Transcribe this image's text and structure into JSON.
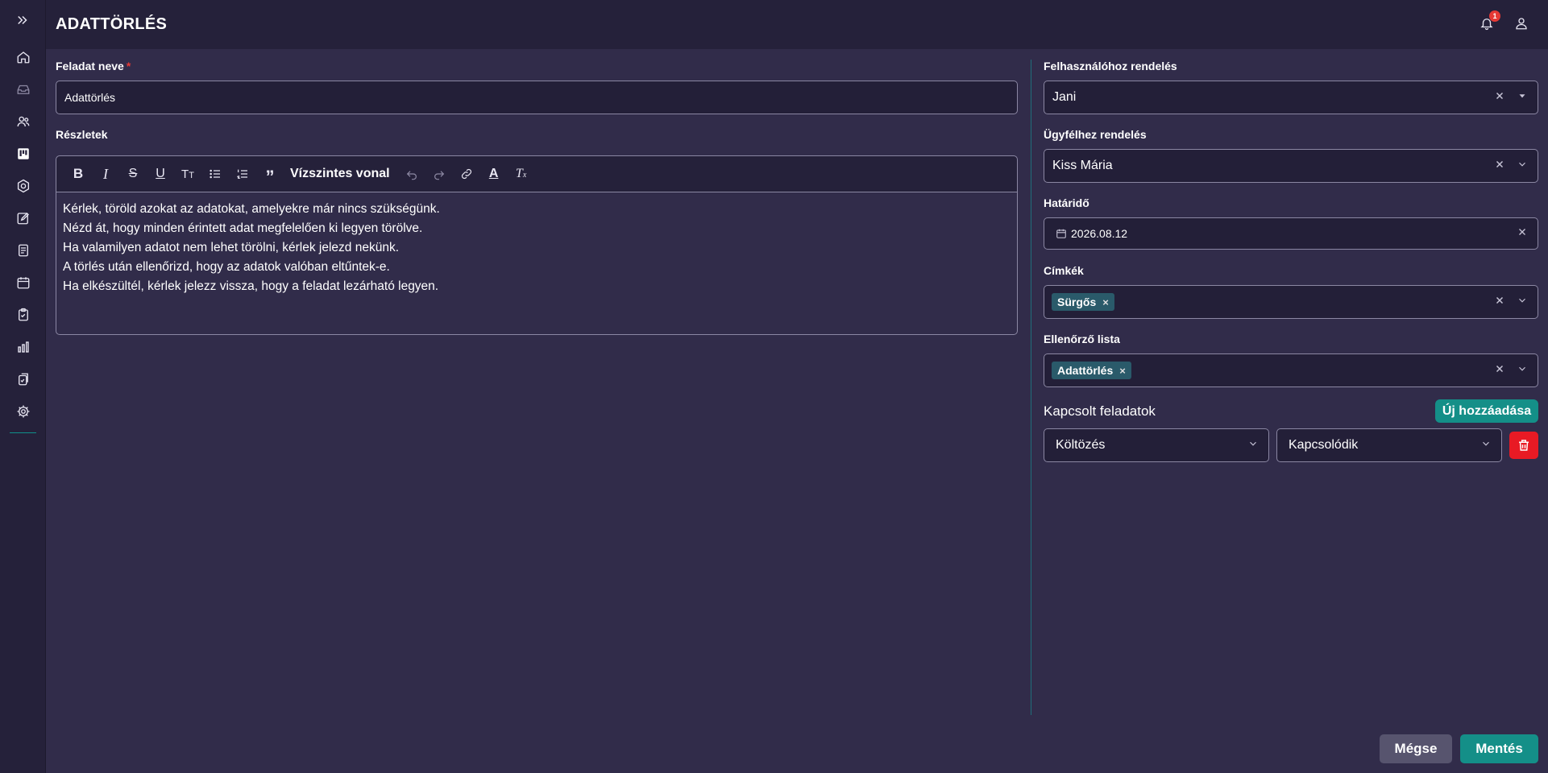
{
  "header": {
    "title": "ADATTÖRLÉS",
    "notification_count": "1"
  },
  "sidebar": {
    "icons": [
      "home-icon",
      "inbox-icon",
      "users-icon",
      "kanban-icon",
      "settings-cog-icon",
      "edit-icon",
      "document-icon",
      "calendar-icon",
      "clipboard-check-icon",
      "bar-chart-icon",
      "clipboard-copy-icon",
      "gear-icon"
    ]
  },
  "form": {
    "task_name_label": "Feladat neve",
    "required_marker": "*",
    "task_name_value": "Adattörlés",
    "details_label": "Részletek",
    "toolbar": {
      "horizontal_rule_label": "Vízszintes vonal"
    },
    "details_lines": [
      "Kérlek, töröld azokat az adatokat, amelyekre már nincs szükségünk.",
      "Nézd át, hogy minden érintett adat megfelelően ki legyen törölve.",
      "Ha valamilyen adatot nem lehet törölni, kérlek jelezd nekünk.",
      "A törlés után ellenőrizd, hogy az adatok valóban eltűntek-e.",
      "Ha elkészültél, kérlek jelezz vissza, hogy a feladat lezárható legyen."
    ]
  },
  "right": {
    "assign_user_label": "Felhasználóhoz rendelés",
    "assign_user_value": "Jani",
    "assign_client_label": "Ügyfélhez rendelés",
    "assign_client_value": "Kiss Mária",
    "deadline_label": "Határidő",
    "deadline_value": "2026.08.12",
    "tags_label": "Címkék",
    "tags": [
      "Sürgős"
    ],
    "checklist_label": "Ellenőrző lista",
    "checklist_tags": [
      "Adattörlés"
    ],
    "linked_tasks_label": "Kapcsolt feladatok",
    "add_new_label": "Új hozzáadása",
    "linked_task_value": "Költözés",
    "relation_value": "Kapcsolódik"
  },
  "footer": {
    "cancel_label": "Mégse",
    "save_label": "Mentés"
  },
  "colors": {
    "accent": "#148f88",
    "danger": "#e81a24",
    "background": "#312c4a",
    "panel": "#25213a"
  }
}
